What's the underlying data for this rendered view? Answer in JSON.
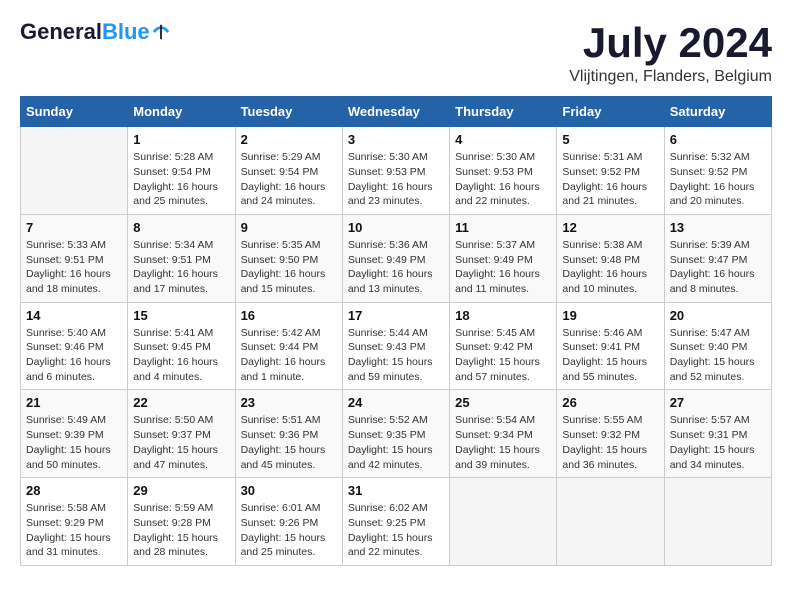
{
  "logo": {
    "line1": "General",
    "line2": "Blue"
  },
  "title": "July 2024",
  "subtitle": "Vlijtingen, Flanders, Belgium",
  "days_header": [
    "Sunday",
    "Monday",
    "Tuesday",
    "Wednesday",
    "Thursday",
    "Friday",
    "Saturday"
  ],
  "weeks": [
    [
      {
        "day": "",
        "info": ""
      },
      {
        "day": "1",
        "info": "Sunrise: 5:28 AM\nSunset: 9:54 PM\nDaylight: 16 hours\nand 25 minutes."
      },
      {
        "day": "2",
        "info": "Sunrise: 5:29 AM\nSunset: 9:54 PM\nDaylight: 16 hours\nand 24 minutes."
      },
      {
        "day": "3",
        "info": "Sunrise: 5:30 AM\nSunset: 9:53 PM\nDaylight: 16 hours\nand 23 minutes."
      },
      {
        "day": "4",
        "info": "Sunrise: 5:30 AM\nSunset: 9:53 PM\nDaylight: 16 hours\nand 22 minutes."
      },
      {
        "day": "5",
        "info": "Sunrise: 5:31 AM\nSunset: 9:52 PM\nDaylight: 16 hours\nand 21 minutes."
      },
      {
        "day": "6",
        "info": "Sunrise: 5:32 AM\nSunset: 9:52 PM\nDaylight: 16 hours\nand 20 minutes."
      }
    ],
    [
      {
        "day": "7",
        "info": "Sunrise: 5:33 AM\nSunset: 9:51 PM\nDaylight: 16 hours\nand 18 minutes."
      },
      {
        "day": "8",
        "info": "Sunrise: 5:34 AM\nSunset: 9:51 PM\nDaylight: 16 hours\nand 17 minutes."
      },
      {
        "day": "9",
        "info": "Sunrise: 5:35 AM\nSunset: 9:50 PM\nDaylight: 16 hours\nand 15 minutes."
      },
      {
        "day": "10",
        "info": "Sunrise: 5:36 AM\nSunset: 9:49 PM\nDaylight: 16 hours\nand 13 minutes."
      },
      {
        "day": "11",
        "info": "Sunrise: 5:37 AM\nSunset: 9:49 PM\nDaylight: 16 hours\nand 11 minutes."
      },
      {
        "day": "12",
        "info": "Sunrise: 5:38 AM\nSunset: 9:48 PM\nDaylight: 16 hours\nand 10 minutes."
      },
      {
        "day": "13",
        "info": "Sunrise: 5:39 AM\nSunset: 9:47 PM\nDaylight: 16 hours\nand 8 minutes."
      }
    ],
    [
      {
        "day": "14",
        "info": "Sunrise: 5:40 AM\nSunset: 9:46 PM\nDaylight: 16 hours\nand 6 minutes."
      },
      {
        "day": "15",
        "info": "Sunrise: 5:41 AM\nSunset: 9:45 PM\nDaylight: 16 hours\nand 4 minutes."
      },
      {
        "day": "16",
        "info": "Sunrise: 5:42 AM\nSunset: 9:44 PM\nDaylight: 16 hours\nand 1 minute."
      },
      {
        "day": "17",
        "info": "Sunrise: 5:44 AM\nSunset: 9:43 PM\nDaylight: 15 hours\nand 59 minutes."
      },
      {
        "day": "18",
        "info": "Sunrise: 5:45 AM\nSunset: 9:42 PM\nDaylight: 15 hours\nand 57 minutes."
      },
      {
        "day": "19",
        "info": "Sunrise: 5:46 AM\nSunset: 9:41 PM\nDaylight: 15 hours\nand 55 minutes."
      },
      {
        "day": "20",
        "info": "Sunrise: 5:47 AM\nSunset: 9:40 PM\nDaylight: 15 hours\nand 52 minutes."
      }
    ],
    [
      {
        "day": "21",
        "info": "Sunrise: 5:49 AM\nSunset: 9:39 PM\nDaylight: 15 hours\nand 50 minutes."
      },
      {
        "day": "22",
        "info": "Sunrise: 5:50 AM\nSunset: 9:37 PM\nDaylight: 15 hours\nand 47 minutes."
      },
      {
        "day": "23",
        "info": "Sunrise: 5:51 AM\nSunset: 9:36 PM\nDaylight: 15 hours\nand 45 minutes."
      },
      {
        "day": "24",
        "info": "Sunrise: 5:52 AM\nSunset: 9:35 PM\nDaylight: 15 hours\nand 42 minutes."
      },
      {
        "day": "25",
        "info": "Sunrise: 5:54 AM\nSunset: 9:34 PM\nDaylight: 15 hours\nand 39 minutes."
      },
      {
        "day": "26",
        "info": "Sunrise: 5:55 AM\nSunset: 9:32 PM\nDaylight: 15 hours\nand 36 minutes."
      },
      {
        "day": "27",
        "info": "Sunrise: 5:57 AM\nSunset: 9:31 PM\nDaylight: 15 hours\nand 34 minutes."
      }
    ],
    [
      {
        "day": "28",
        "info": "Sunrise: 5:58 AM\nSunset: 9:29 PM\nDaylight: 15 hours\nand 31 minutes."
      },
      {
        "day": "29",
        "info": "Sunrise: 5:59 AM\nSunset: 9:28 PM\nDaylight: 15 hours\nand 28 minutes."
      },
      {
        "day": "30",
        "info": "Sunrise: 6:01 AM\nSunset: 9:26 PM\nDaylight: 15 hours\nand 25 minutes."
      },
      {
        "day": "31",
        "info": "Sunrise: 6:02 AM\nSunset: 9:25 PM\nDaylight: 15 hours\nand 22 minutes."
      },
      {
        "day": "",
        "info": ""
      },
      {
        "day": "",
        "info": ""
      },
      {
        "day": "",
        "info": ""
      }
    ]
  ]
}
